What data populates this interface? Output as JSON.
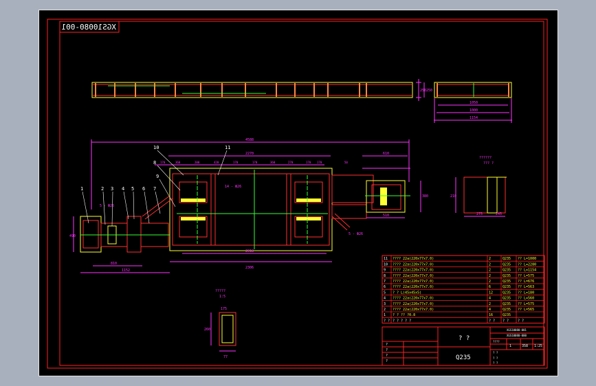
{
  "drawing_number": "XGS10080-001",
  "colors": {
    "background": "#000000",
    "frame": "#ff2020",
    "dimension": "#ff33ff",
    "outline": "#ffff33",
    "steel": "#ff3030",
    "hatch": "#ff8844",
    "centerline": "#33ff33",
    "text": "#ffffff"
  },
  "top_view": {
    "right_overall_dim": "1950"
  },
  "end_view": {
    "dims": [
      "1050",
      "1000",
      "1154"
    ],
    "height_dim": "250"
  },
  "plan_view": {
    "overall_dim": "4588",
    "dims_upper": [
      "2270",
      "610",
      "170",
      "360",
      "200",
      "420",
      "170",
      "170",
      "360",
      "270",
      "170",
      "170",
      "50"
    ],
    "dims_lower": [
      "2018",
      "2306",
      "1152",
      "810",
      "510"
    ],
    "side_dims": [
      "490",
      "380"
    ],
    "note_left": "5 - Ф26",
    "note_center": "14 - Ф26",
    "note_right": "5 - Ф26",
    "balloons": [
      "1",
      "2",
      "3",
      "4",
      "5",
      "6",
      "7",
      "8",
      "9",
      "10",
      "11"
    ]
  },
  "section_view_a": {
    "label": "??????",
    "sub_label": "??? ?",
    "dims": [
      "210",
      "275",
      "245"
    ]
  },
  "section_view_b": {
    "label": "?????",
    "sub_label": "1:5",
    "dims": [
      "175",
      "260",
      "77"
    ]
  },
  "bom": {
    "rows": [
      {
        "no": "11",
        "desc": "???? 22a(220x77x7.0)",
        "qty": "2",
        "mat": "Q235",
        "note": "?? L=1000"
      },
      {
        "no": "10",
        "desc": "???? 22a(220x77x7.0)",
        "qty": "2",
        "mat": "Q235",
        "note": "?? L=2280"
      },
      {
        "no": "9",
        "desc": "???? 22a(220x77x7.0)",
        "qty": "2",
        "mat": "Q235",
        "note": "?? L=1154"
      },
      {
        "no": "8",
        "desc": "???? 22a(220x77x7.0)",
        "qty": "2",
        "mat": "Q235",
        "note": "?? L=575"
      },
      {
        "no": "7",
        "desc": "???? 22a(220x77x7.0)",
        "qty": "2",
        "mat": "Q235",
        "note": "?? L=676"
      },
      {
        "no": "6",
        "desc": "???? 22a(220x77x7.0)",
        "qty": "6",
        "mat": "Q235",
        "note": "?? L=563"
      },
      {
        "no": "5",
        "desc": "? ? L(45x45x5)",
        "qty": "12",
        "mat": "Q235",
        "note": "?? L=180"
      },
      {
        "no": "4",
        "desc": "???? 22a(220x77x7.0)",
        "qty": "4",
        "mat": "Q235",
        "note": "?? L=560"
      },
      {
        "no": "3",
        "desc": "???? 22a(220x77x7.0)",
        "qty": "2",
        "mat": "Q235",
        "note": "?? L=575"
      },
      {
        "no": "2",
        "desc": "???? 22a(220x77x7.0)",
        "qty": "4",
        "mat": "Q235",
        "note": "?? L=565"
      },
      {
        "no": "1",
        "desc": "? ? ?? ?0.8",
        "qty": "16",
        "mat": "Q235",
        "note": ""
      }
    ],
    "header": {
      "no": "? ?",
      "desc": "? ? ? ? ?",
      "qty": "? ?",
      "mat": "? ?",
      "note": "? ?"
    }
  },
  "title_block": {
    "name": "? ?",
    "material": "Q235",
    "code_1": "XGS10080-001",
    "code_2": "XGS10080-000",
    "scale": "1:25",
    "sheet": "1",
    "weight": "358",
    "left_labels": [
      "?",
      "?",
      "?",
      "?"
    ],
    "right_labels": [
      "????",
      "? ?",
      "? ?",
      "? ?"
    ]
  }
}
